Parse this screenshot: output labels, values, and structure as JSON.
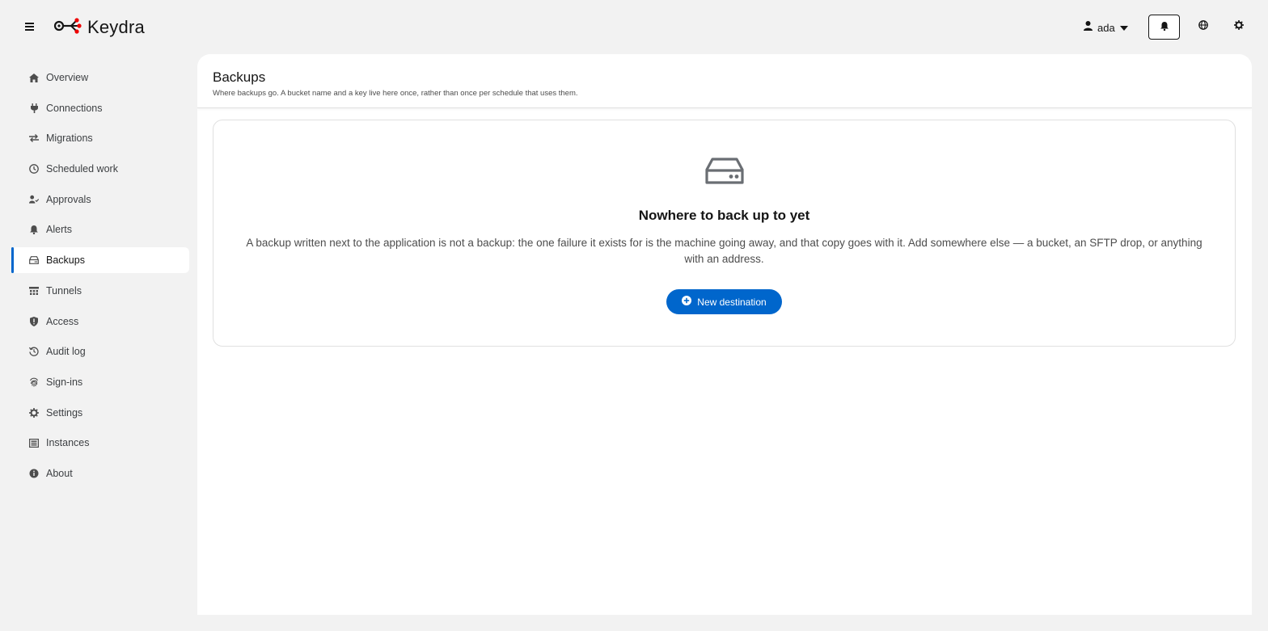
{
  "app": {
    "brand": "Keydra"
  },
  "header": {
    "user": "ada",
    "icons": {
      "menu": "hamburger-icon",
      "user": "user-icon",
      "notifications": "bell-icon",
      "language": "globe-icon",
      "theme": "gear-icon"
    }
  },
  "sidebar": {
    "items": [
      {
        "label": "Overview",
        "icon": "home-icon"
      },
      {
        "label": "Connections",
        "icon": "plug-icon"
      },
      {
        "label": "Migrations",
        "icon": "arrows-exchange-icon"
      },
      {
        "label": "Scheduled work",
        "icon": "clock-icon"
      },
      {
        "label": "Approvals",
        "icon": "user-check-icon"
      },
      {
        "label": "Alerts",
        "icon": "bell-icon"
      },
      {
        "label": "Backups",
        "icon": "hard-drive-icon",
        "active": true
      },
      {
        "label": "Tunnels",
        "icon": "network-icon"
      },
      {
        "label": "Access",
        "icon": "shield-icon"
      },
      {
        "label": "Audit log",
        "icon": "history-icon"
      },
      {
        "label": "Sign-ins",
        "icon": "fingerprint-icon"
      },
      {
        "label": "Settings",
        "icon": "gear-icon"
      },
      {
        "label": "Instances",
        "icon": "server-icon"
      },
      {
        "label": "About",
        "icon": "info-icon"
      }
    ]
  },
  "page": {
    "title": "Backups",
    "subtitle": "Where backups go. A bucket name and a key live here once, rather than once per schedule that uses them."
  },
  "empty_state": {
    "icon": "hard-drive-icon",
    "title": "Nowhere to back up to yet",
    "body": "A backup written next to the application is not a backup: the one failure it exists for is the machine going away, and that copy goes with it. Add somewhere else — a bucket, an SFTP drop, or anything with an address.",
    "button": "New destination",
    "button_icon": "plus-circle-icon"
  },
  "colors": {
    "accent": "#0066cc",
    "brand_red": "#ee0000",
    "background": "#f2f2f2"
  }
}
